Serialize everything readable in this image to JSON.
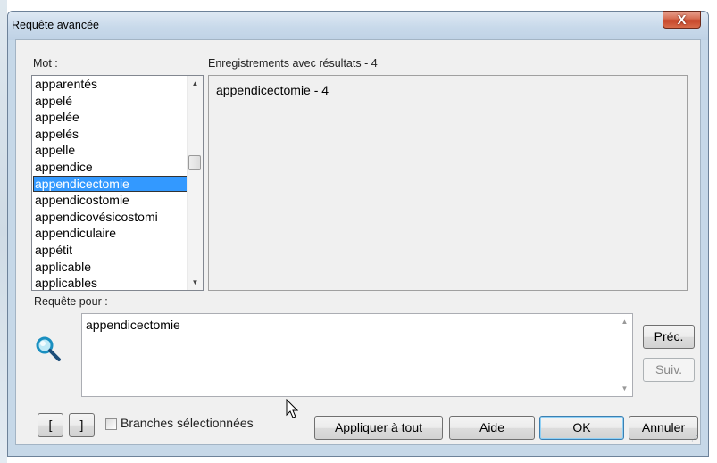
{
  "window": {
    "title": "Requête avancée",
    "close_label": "X"
  },
  "labels": {
    "word": "Mot :",
    "records": "Enregistrements avec résultats - 4",
    "query_for": "Requête pour :"
  },
  "word_list": {
    "items": [
      "apparentés",
      "appelé",
      "appelée",
      "appelés",
      "appelle",
      "appendice",
      "appendicectomie",
      "appendicostomie",
      "appendicovésicostomi",
      "appendiculaire",
      "appétit",
      "applicable",
      "applicables"
    ],
    "selected": "appendicectomie"
  },
  "results": [
    "appendicectomie - 4"
  ],
  "query": {
    "text": "appendicectomie"
  },
  "buttons": {
    "prev": "Préc.",
    "next": "Suiv.",
    "open_bracket": "[",
    "close_bracket": "]",
    "selected_branches": "Branches sélectionnées",
    "apply_all": "Appliquer à tout",
    "help": "Aide",
    "ok": "OK",
    "cancel": "Annuler"
  },
  "icons": {
    "search": "search-icon",
    "cursor": "mouse-pointer-icon"
  },
  "colors": {
    "selection": "#3399ff",
    "title_bar": "#c8d9ea",
    "close": "#c6462a",
    "default_button_border": "#3c7fb1"
  }
}
